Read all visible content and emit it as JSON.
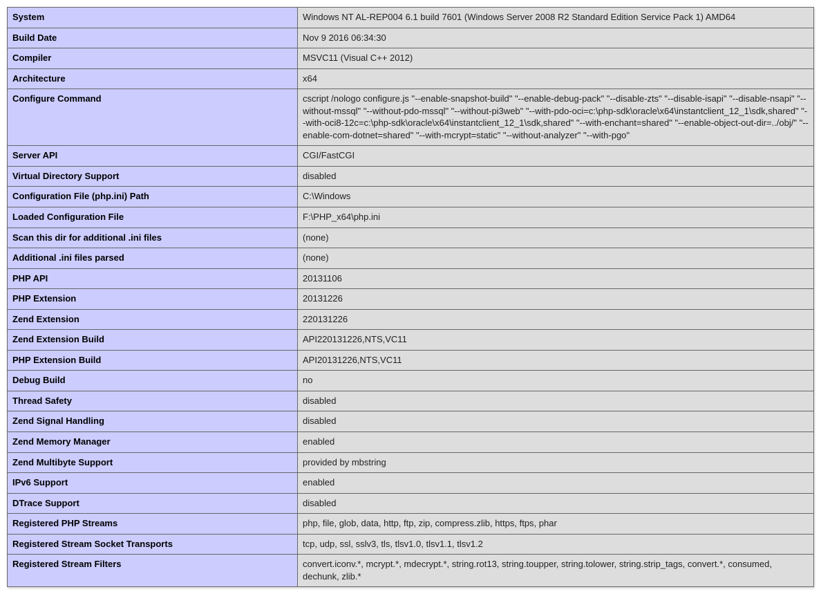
{
  "rows": [
    {
      "label": "System",
      "value": "Windows NT AL-REP004 6.1 build 7601 (Windows Server 2008 R2 Standard Edition Service Pack 1) AMD64"
    },
    {
      "label": "Build Date",
      "value": "Nov 9 2016 06:34:30"
    },
    {
      "label": "Compiler",
      "value": "MSVC11 (Visual C++ 2012)"
    },
    {
      "label": "Architecture",
      "value": "x64"
    },
    {
      "label": "Configure Command",
      "value": "cscript /nologo configure.js \"--enable-snapshot-build\" \"--enable-debug-pack\" \"--disable-zts\" \"--disable-isapi\" \"--disable-nsapi\" \"--without-mssql\" \"--without-pdo-mssql\" \"--without-pi3web\" \"--with-pdo-oci=c:\\php-sdk\\oracle\\x64\\instantclient_12_1\\sdk,shared\" \"--with-oci8-12c=c:\\php-sdk\\oracle\\x64\\instantclient_12_1\\sdk,shared\" \"--with-enchant=shared\" \"--enable-object-out-dir=../obj/\" \"--enable-com-dotnet=shared\" \"--with-mcrypt=static\" \"--without-analyzer\" \"--with-pgo\""
    },
    {
      "label": "Server API",
      "value": "CGI/FastCGI"
    },
    {
      "label": "Virtual Directory Support",
      "value": "disabled"
    },
    {
      "label": "Configuration File (php.ini) Path",
      "value": "C:\\Windows"
    },
    {
      "label": "Loaded Configuration File",
      "value": "F:\\PHP_x64\\php.ini"
    },
    {
      "label": "Scan this dir for additional .ini files",
      "value": "(none)"
    },
    {
      "label": "Additional .ini files parsed",
      "value": "(none)"
    },
    {
      "label": "PHP API",
      "value": "20131106"
    },
    {
      "label": "PHP Extension",
      "value": "20131226"
    },
    {
      "label": "Zend Extension",
      "value": "220131226"
    },
    {
      "label": "Zend Extension Build",
      "value": "API220131226,NTS,VC11"
    },
    {
      "label": "PHP Extension Build",
      "value": "API20131226,NTS,VC11"
    },
    {
      "label": "Debug Build",
      "value": "no"
    },
    {
      "label": "Thread Safety",
      "value": "disabled"
    },
    {
      "label": "Zend Signal Handling",
      "value": "disabled"
    },
    {
      "label": "Zend Memory Manager",
      "value": "enabled"
    },
    {
      "label": "Zend Multibyte Support",
      "value": "provided by mbstring"
    },
    {
      "label": "IPv6 Support",
      "value": "enabled"
    },
    {
      "label": "DTrace Support",
      "value": "disabled"
    },
    {
      "label": "Registered PHP Streams",
      "value": "php, file, glob, data, http, ftp, zip, compress.zlib, https, ftps, phar"
    },
    {
      "label": "Registered Stream Socket Transports",
      "value": "tcp, udp, ssl, sslv3, tls, tlsv1.0, tlsv1.1, tlsv1.2"
    },
    {
      "label": "Registered Stream Filters",
      "value": "convert.iconv.*, mcrypt.*, mdecrypt.*, string.rot13, string.toupper, string.tolower, string.strip_tags, convert.*, consumed, dechunk, zlib.*"
    }
  ]
}
